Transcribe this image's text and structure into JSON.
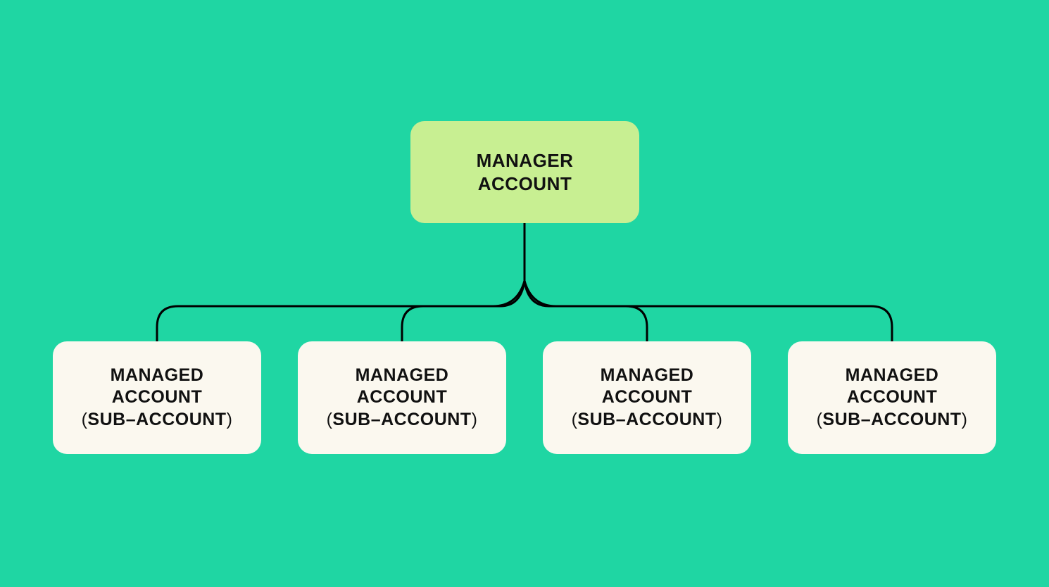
{
  "colors": {
    "background": "#1fd6a3",
    "rootFill": "#c8ef92",
    "childFill": "#fbf8ef",
    "stroke": "#000000"
  },
  "root": {
    "line1": "MANAGER",
    "line2": "ACCOUNT"
  },
  "child": {
    "line1": "MANAGED",
    "line2": "ACCOUNT",
    "sub": "SUB–ACCOUNT",
    "openParen": "(",
    "closeParen": ")"
  },
  "children": [
    0,
    1,
    2,
    3
  ]
}
